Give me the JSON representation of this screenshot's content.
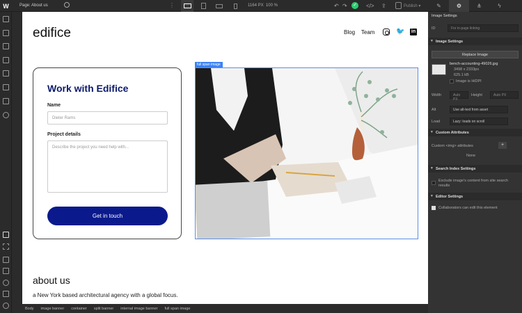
{
  "topbar": {
    "logo": "W",
    "page_label": "Page: About us",
    "width_px": "1164 PX",
    "zoom": "100 %",
    "publish": "Publish ▾"
  },
  "canvas": {
    "brand": "edifice",
    "nav": {
      "blog": "Blog",
      "team": "Team"
    },
    "card": {
      "title": "Work with Edifice",
      "name_label": "Name",
      "name_placeholder": "Dieter Rams",
      "project_label": "Project details",
      "project_placeholder": "Describe the project you need help with...",
      "cta": "Get in touch"
    },
    "image_tag": "full span image",
    "about_title": "about us",
    "about_text": "a New York based architectural agency with a global focus."
  },
  "breadcrumb": [
    "Body",
    "image banner",
    "container",
    "split banner",
    "internal image banner",
    "full span image"
  ],
  "panel": {
    "header": "Image Settings",
    "id_label": "ID",
    "id_placeholder": "For in-page linking",
    "section_image": "Image Settings",
    "replace": "Replace Image",
    "file_name": "bench-accounting-49026.jpg",
    "file_dims": "3498 x 2333px",
    "file_size": "625.1 kB",
    "hidpi": "Image is HiDPI",
    "width_label": "Width",
    "width_value": "Auto",
    "height_label": "Height",
    "height_value": "Auto",
    "px": "PX",
    "alt_label": "Alt",
    "alt_value": "Use alt-text from asset",
    "load_label": "Load",
    "load_value": "Lazy: loads on scroll",
    "section_custom": "Custom Attributes",
    "custom_label": "Custom <img> attributes",
    "custom_none": "None",
    "section_search": "Search Index Settings",
    "search_text": "Exclude image's content from site search results",
    "section_editor": "Editor Settings",
    "editor_text": "Collaborators can edit this element"
  },
  "colors": {
    "accent": "#0a1a8c",
    "selection": "#3b82f6",
    "publish_check": "#2ecc71"
  }
}
